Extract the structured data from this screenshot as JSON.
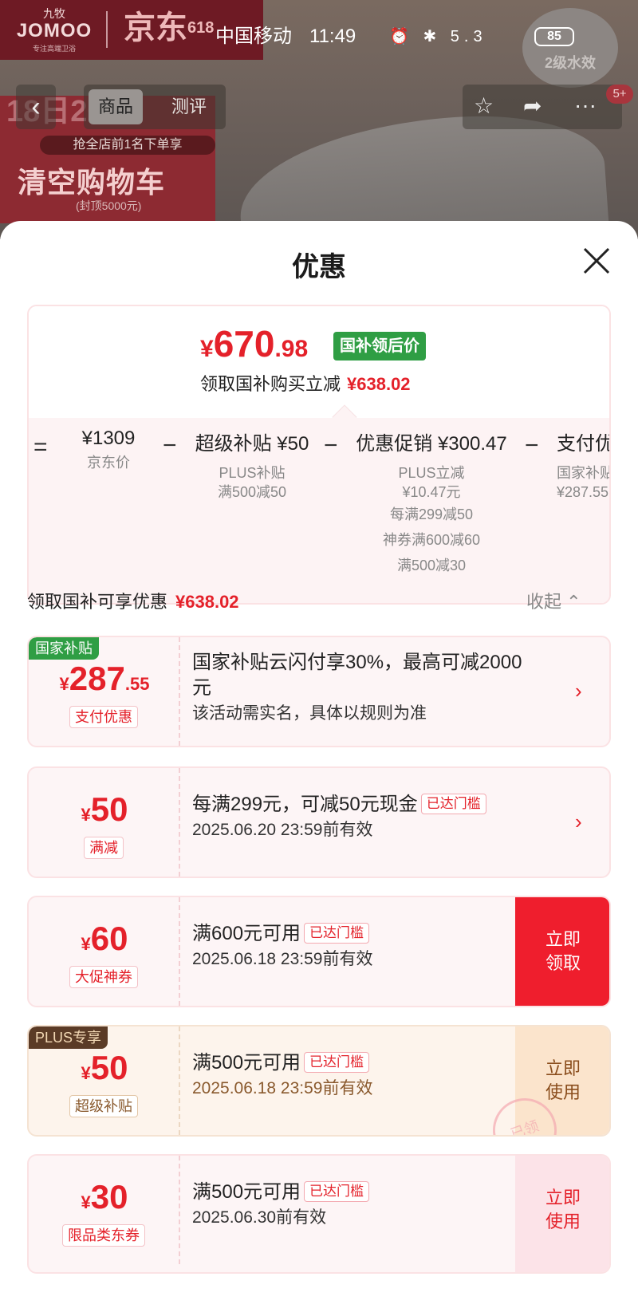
{
  "banner": {
    "brand": "JOMOO",
    "brand_cn": "九牧",
    "brand_sub": "专注高端卫浴",
    "jd": "京东",
    "jd_sub": "618",
    "promo_top": "18日20",
    "promo_pill": "抢全店前1名下单享",
    "promo_main": "清空购物车",
    "promo_cap": "(封顶5000元)",
    "water_badge": "2级水效"
  },
  "status": {
    "carrier": "中国移动",
    "time": "11:49",
    "icons": "⏰ ✱ 5.3",
    "battery": "85"
  },
  "nav": {
    "back": "‹",
    "tab_product": "商品",
    "tab_review": "测评",
    "star": "☆",
    "share": "➦",
    "more": "···",
    "cart_badge": "5+"
  },
  "sheet": {
    "title": "优惠"
  },
  "price_card": {
    "symbol": "¥",
    "price_int": "670",
    "price_dec": ".98",
    "tag": "国补领后价",
    "reduce_label": "领取国补购买立减",
    "reduce_amount": "¥638.02",
    "eq": "=",
    "minus": "−",
    "columns": [
      {
        "head": "¥1309",
        "subs": [
          "京东价"
        ]
      },
      {
        "head": "超级补贴 ¥50",
        "subs": [
          "PLUS补贴",
          "满500减50"
        ]
      },
      {
        "head": "优惠促销 ¥300.47",
        "subs": [
          "PLUS立减",
          "¥10.47元",
          "每满299减50",
          "神券满600减60",
          "满500减30"
        ]
      },
      {
        "head": "支付优",
        "subs": [
          "国家补贴",
          "¥287.55"
        ]
      }
    ]
  },
  "section": {
    "label": "领取国补可享优惠",
    "amount": "¥638.02",
    "collapse": "收起 ⌃"
  },
  "coupons": [
    {
      "corner": "国家补贴",
      "symbol": "¥",
      "int": "287",
      "dec": ".55",
      "label": "支付优惠",
      "title": "国家补贴云闪付享30%，最高可减2000元",
      "tag": "",
      "desc": "该活动需实名，具体以规则为准",
      "arrow": "›",
      "action": ""
    },
    {
      "corner": "",
      "symbol": "¥",
      "int": "50",
      "dec": "",
      "label": "满减",
      "title": "每满299元，可减50元现金",
      "tag": "已达门槛",
      "desc": "2025.06.20 23:59前有效",
      "arrow": "›",
      "action": ""
    },
    {
      "corner": "",
      "symbol": "¥",
      "int": "60",
      "dec": "",
      "label": "大促神券",
      "title": "满600元可用",
      "tag": "已达门槛",
      "desc": "2025.06.18 23:59前有效",
      "arrow": "",
      "action": "立即领取"
    },
    {
      "corner": "PLUS专享",
      "symbol": "¥",
      "int": "50",
      "dec": "",
      "label": "超级补贴",
      "title": "满500元可用",
      "tag": "已达门槛",
      "desc": "2025.06.18 23:59前有效",
      "arrow": "",
      "action": "立即使用",
      "stamp": "已领"
    },
    {
      "corner": "",
      "symbol": "¥",
      "int": "30",
      "dec": "",
      "label": "限品类东券",
      "title": "满500元可用",
      "tag": "已达门槛",
      "desc": "2025.06.30前有效",
      "arrow": "",
      "action": "立即使用"
    }
  ],
  "colors": {
    "accent_red": "#e4212a",
    "green_tag": "#2f9e44",
    "plus_brown": "#5b3b26"
  }
}
